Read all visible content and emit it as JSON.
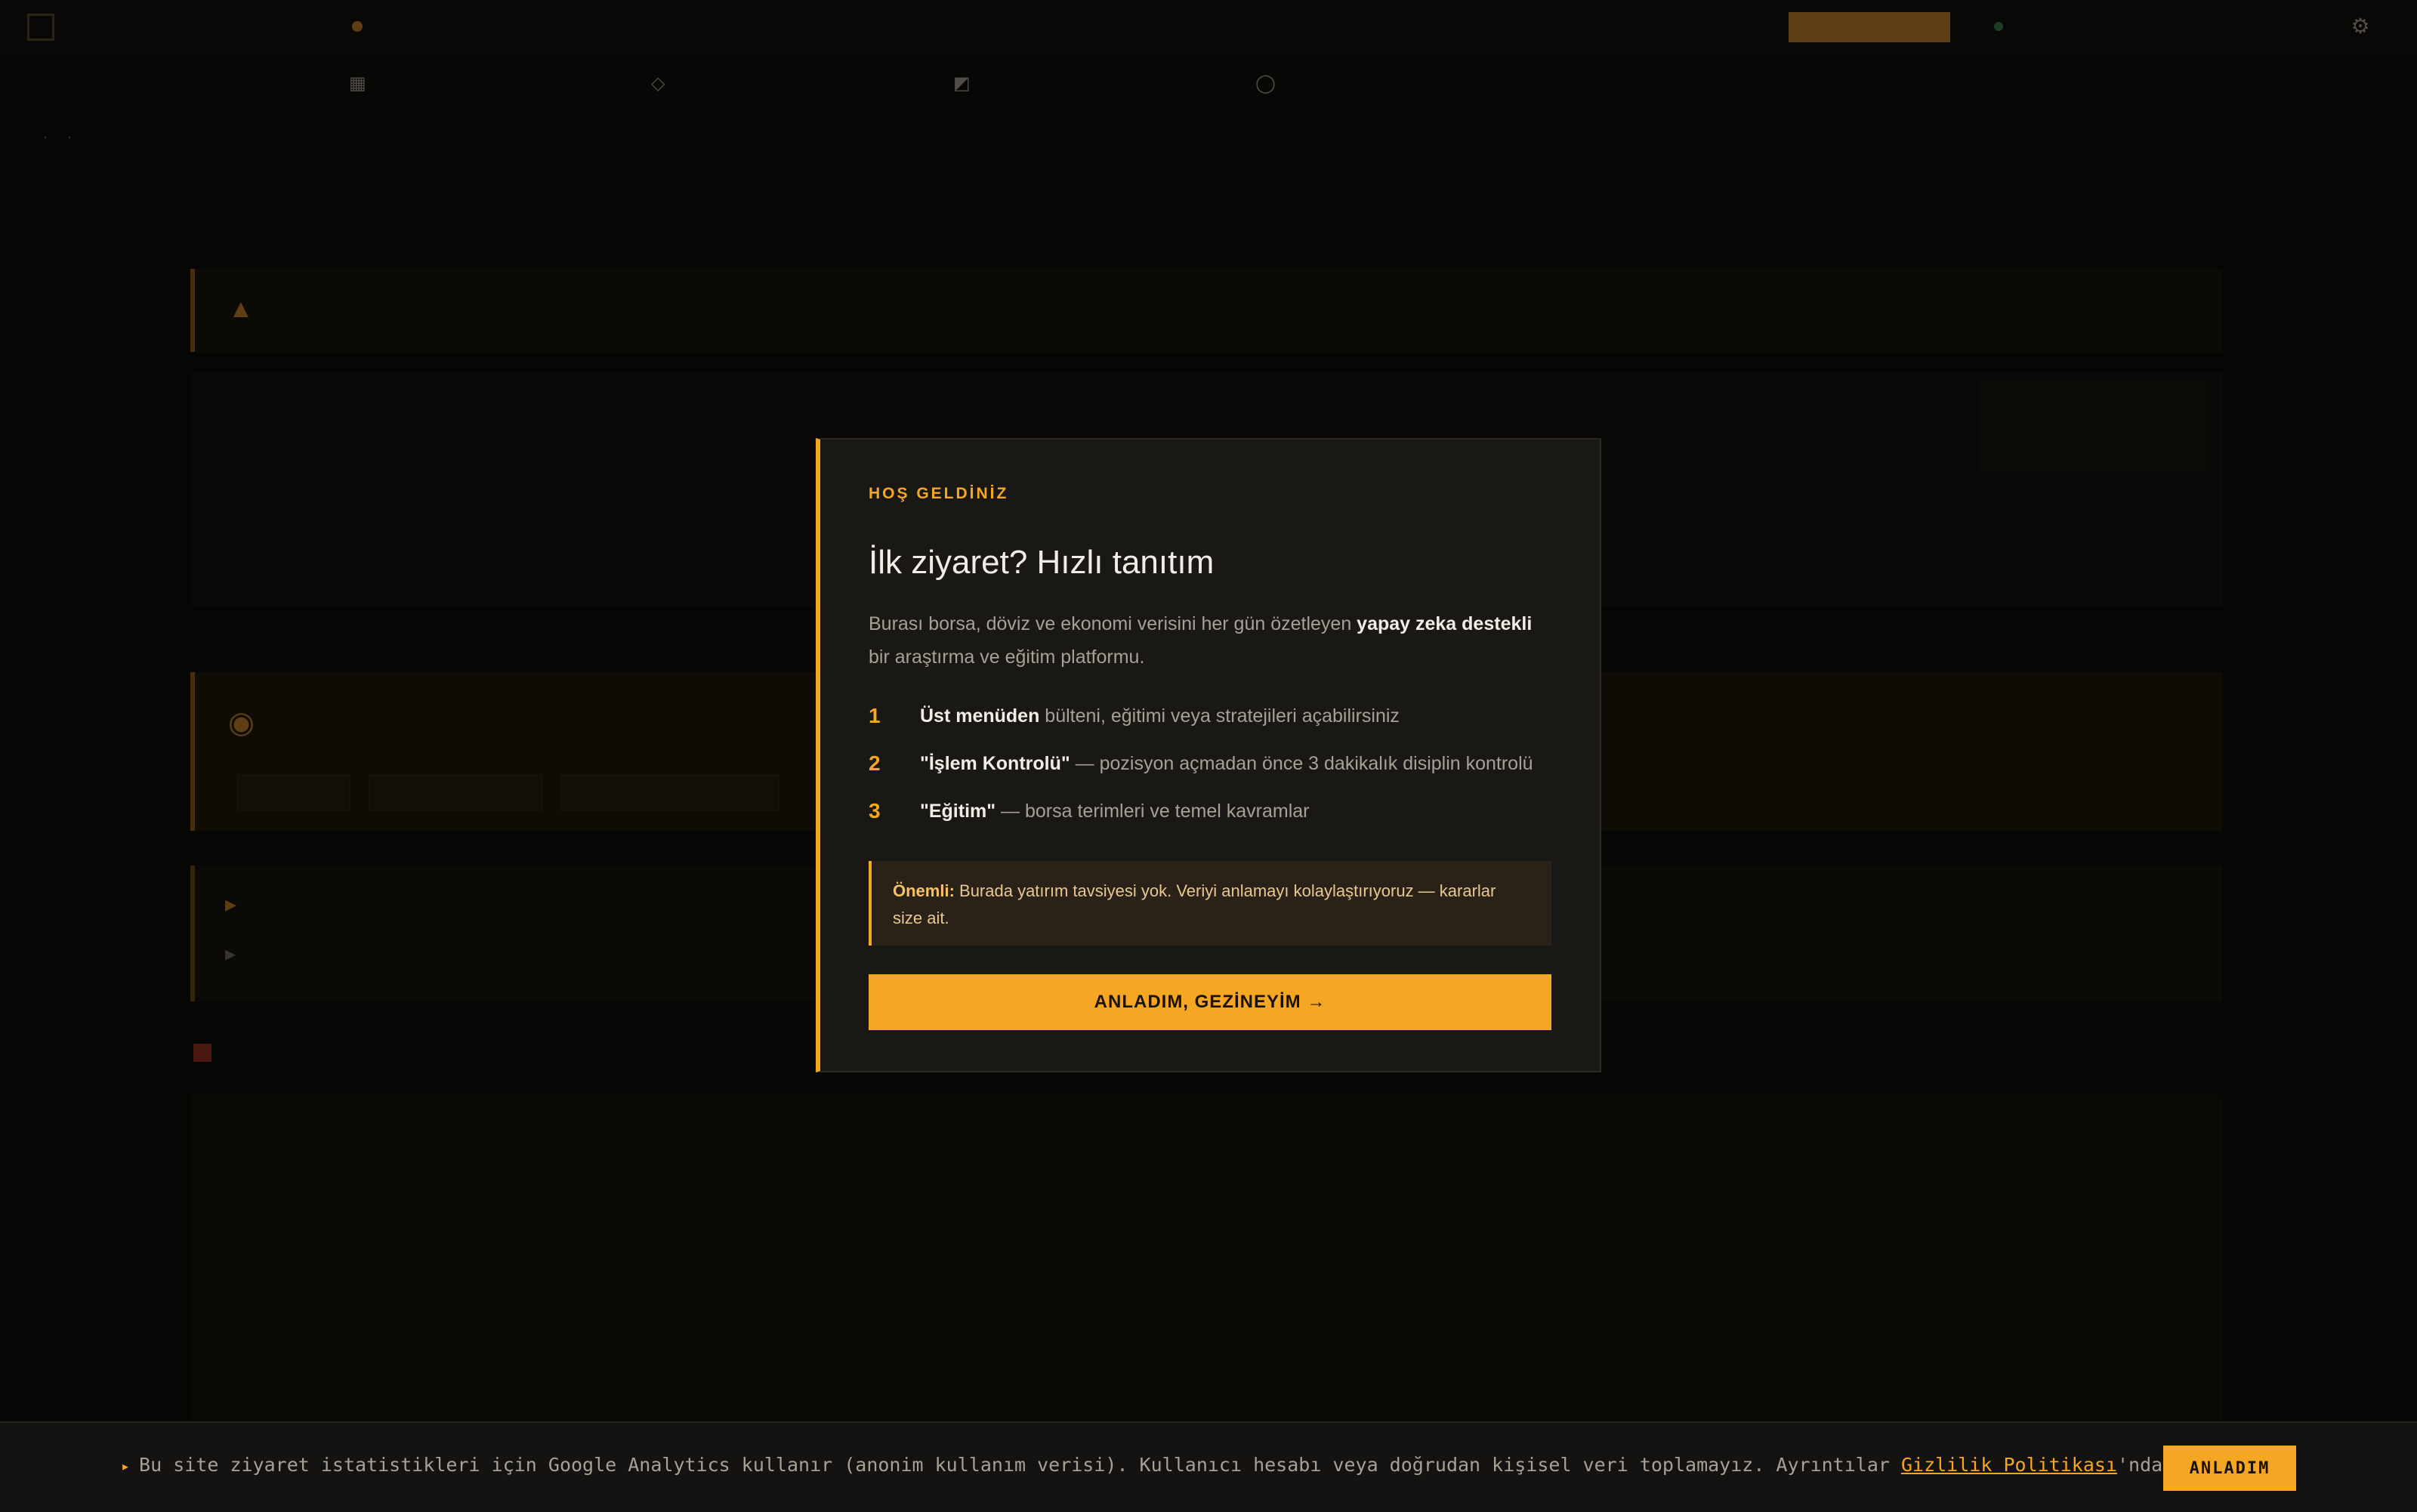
{
  "colors": {
    "accent": "#f5a623",
    "background": "#0d0c0a",
    "modal_bg": "#1a1815",
    "note_bg": "#2a2118",
    "danger": "#c0392b"
  },
  "topbar": {
    "logo_text": "",
    "logo_sub": "",
    "ticker_bold": "",
    "ticker_text": "",
    "status_text": "",
    "time_text": ""
  },
  "nav": {
    "items": [
      "",
      "",
      "",
      "",
      "",
      ""
    ]
  },
  "breadcrumb": {
    "home": "",
    "section": "",
    "current": "",
    "note": ""
  },
  "page": {
    "warning_text": "",
    "article_meta": "",
    "article_title": "",
    "article_desc": "",
    "stats_title": "",
    "stats_sub": "",
    "quick_link_1": "",
    "quick_link_2": "",
    "section_title": "",
    "table_title": ""
  },
  "modal": {
    "eyebrow": "HOŞ GELDİNİZ",
    "title": "İlk ziyaret? Hızlı tanıtım",
    "lead_before": "Burası borsa, döviz ve ekonomi verisini her gün özetleyen ",
    "lead_bold": "yapay zeka destekli",
    "lead_after": " bir araştırma ve eğitim platformu.",
    "steps": [
      {
        "num": "1",
        "bold": "Üst menüden",
        "text": " bülteni, eğitimi veya stratejileri açabilirsiniz"
      },
      {
        "num": "2",
        "bold": "\"İşlem Kontrolü\"",
        "text": " — pozisyon açmadan önce 3 dakikalık disiplin kontrolü"
      },
      {
        "num": "3",
        "bold": "\"Eğitim\"",
        "text": " — borsa terimleri ve temel kavramlar"
      }
    ],
    "note_bold": "Önemli:",
    "note_text": " Burada yatırım tavsiyesi yok. Veriyi anlamayı kolaylaştırıyoruz — kararlar size ait.",
    "button_label": "ANLADIM, GEZİNEYİM →"
  },
  "cookie": {
    "text": "Bu site ziyaret istatistikleri için Google Analytics kullanır (anonim kullanım verisi). Kullanıcı hesabı veya doğrudan kişisel veri toplamayız. Ayrıntılar ",
    "link": "Gizlilik Politikası",
    "text_after": "'nda.",
    "button_label": "ANLADIM"
  }
}
